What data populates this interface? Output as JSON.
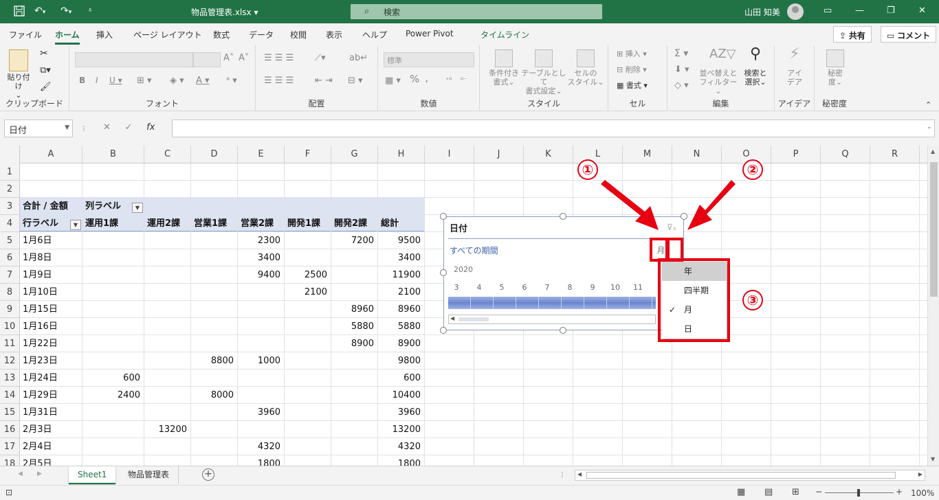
{
  "titlebar": {
    "filename": "物品管理表.xlsx",
    "filename_caret": "▾",
    "search_placeholder": "検索",
    "user_name": "山田 知美"
  },
  "menu": {
    "tabs": [
      "ファイル",
      "ホーム",
      "挿入",
      "ページ レイアウト",
      "数式",
      "データ",
      "校閲",
      "表示",
      "ヘルプ",
      "Power Pivot",
      "タイムライン"
    ],
    "active_tab": "ホーム",
    "share_label": "共有",
    "comment_label": "コメント"
  },
  "ribbon": {
    "groups": [
      "クリップボード",
      "フォント",
      "配置",
      "数値",
      "スタイル",
      "セル",
      "編集",
      "アイデア",
      "秘密度"
    ],
    "paste_label": "貼り付け",
    "number_format": "標準",
    "conditional_label1": "条件付き",
    "conditional_label2": "書式",
    "table_label1": "テーブルとして",
    "table_label2": "書式設定",
    "cellstyle_label1": "セルの",
    "cellstyle_label2": "スタイル",
    "insert_label": "挿入",
    "delete_label": "削除",
    "format_label": "書式",
    "sort_label1": "並べ替えと",
    "sort_label2": "フィルター",
    "find_label1": "検索と",
    "find_label2": "選択",
    "idea_label1": "アイ",
    "idea_label2": "デア",
    "secret_label1": "秘密",
    "secret_label2": "度"
  },
  "formulabar": {
    "name_box": "日付",
    "value": ""
  },
  "columns": [
    "A",
    "B",
    "C",
    "D",
    "E",
    "F",
    "G",
    "H",
    "I",
    "J",
    "K",
    "L",
    "M",
    "N",
    "O",
    "P",
    "Q",
    "R"
  ],
  "rows": [
    "1",
    "2",
    "3",
    "4",
    "5",
    "6",
    "7",
    "8",
    "9",
    "10",
    "11",
    "12",
    "13",
    "14",
    "15",
    "16",
    "17",
    "18"
  ],
  "pivot": {
    "sum_label": "合計 / 金額",
    "col_label": "列ラベル",
    "row_label": "行ラベル",
    "headers": [
      "運用1課",
      "運用2課",
      "営業1課",
      "営業2課",
      "開発1課",
      "開発2課",
      "総計"
    ],
    "data": [
      {
        "date": "1月6日",
        "vals": [
          "",
          "",
          "",
          "2300",
          "",
          "7200",
          "9500"
        ]
      },
      {
        "date": "1月8日",
        "vals": [
          "",
          "",
          "",
          "3400",
          "",
          "",
          "3400"
        ]
      },
      {
        "date": "1月9日",
        "vals": [
          "",
          "",
          "",
          "9400",
          "2500",
          "",
          "11900"
        ]
      },
      {
        "date": "1月10日",
        "vals": [
          "",
          "",
          "",
          "",
          "2100",
          "",
          "2100"
        ]
      },
      {
        "date": "1月15日",
        "vals": [
          "",
          "",
          "",
          "",
          "",
          "8960",
          "8960"
        ]
      },
      {
        "date": "1月16日",
        "vals": [
          "",
          "",
          "",
          "",
          "",
          "5880",
          "5880"
        ]
      },
      {
        "date": "1月22日",
        "vals": [
          "",
          "",
          "",
          "",
          "",
          "8900",
          "8900"
        ]
      },
      {
        "date": "1月23日",
        "vals": [
          "",
          "",
          "8800",
          "1000",
          "",
          "",
          "9800"
        ]
      },
      {
        "date": "1月24日",
        "vals": [
          "600",
          "",
          "",
          "",
          "",
          "",
          "600"
        ]
      },
      {
        "date": "1月29日",
        "vals": [
          "2400",
          "",
          "8000",
          "",
          "",
          "",
          "10400"
        ]
      },
      {
        "date": "1月31日",
        "vals": [
          "",
          "",
          "",
          "3960",
          "",
          "",
          "3960"
        ]
      },
      {
        "date": "2月3日",
        "vals": [
          "",
          "13200",
          "",
          "",
          "",
          "",
          "13200"
        ]
      },
      {
        "date": "2月4日",
        "vals": [
          "",
          "",
          "",
          "4320",
          "",
          "",
          "4320"
        ]
      },
      {
        "date": "2月5日",
        "vals": [
          "",
          "",
          "",
          "1800",
          "",
          "",
          "1800"
        ]
      }
    ]
  },
  "slicer": {
    "title": "日付",
    "period_label": "すべての期間",
    "level": "月",
    "year": "2020",
    "months": [
      "3",
      "4",
      "5",
      "6",
      "7",
      "8",
      "9",
      "10",
      "11"
    ]
  },
  "level_menu": {
    "items": [
      "年",
      "四半期",
      "月",
      "日"
    ],
    "checked": "月",
    "highlighted": "年",
    "check_mark": "✓"
  },
  "callouts": [
    "①",
    "②",
    "③"
  ],
  "sheets": [
    "Sheet1",
    "物品管理表"
  ],
  "status": {
    "zoom": "100%"
  }
}
